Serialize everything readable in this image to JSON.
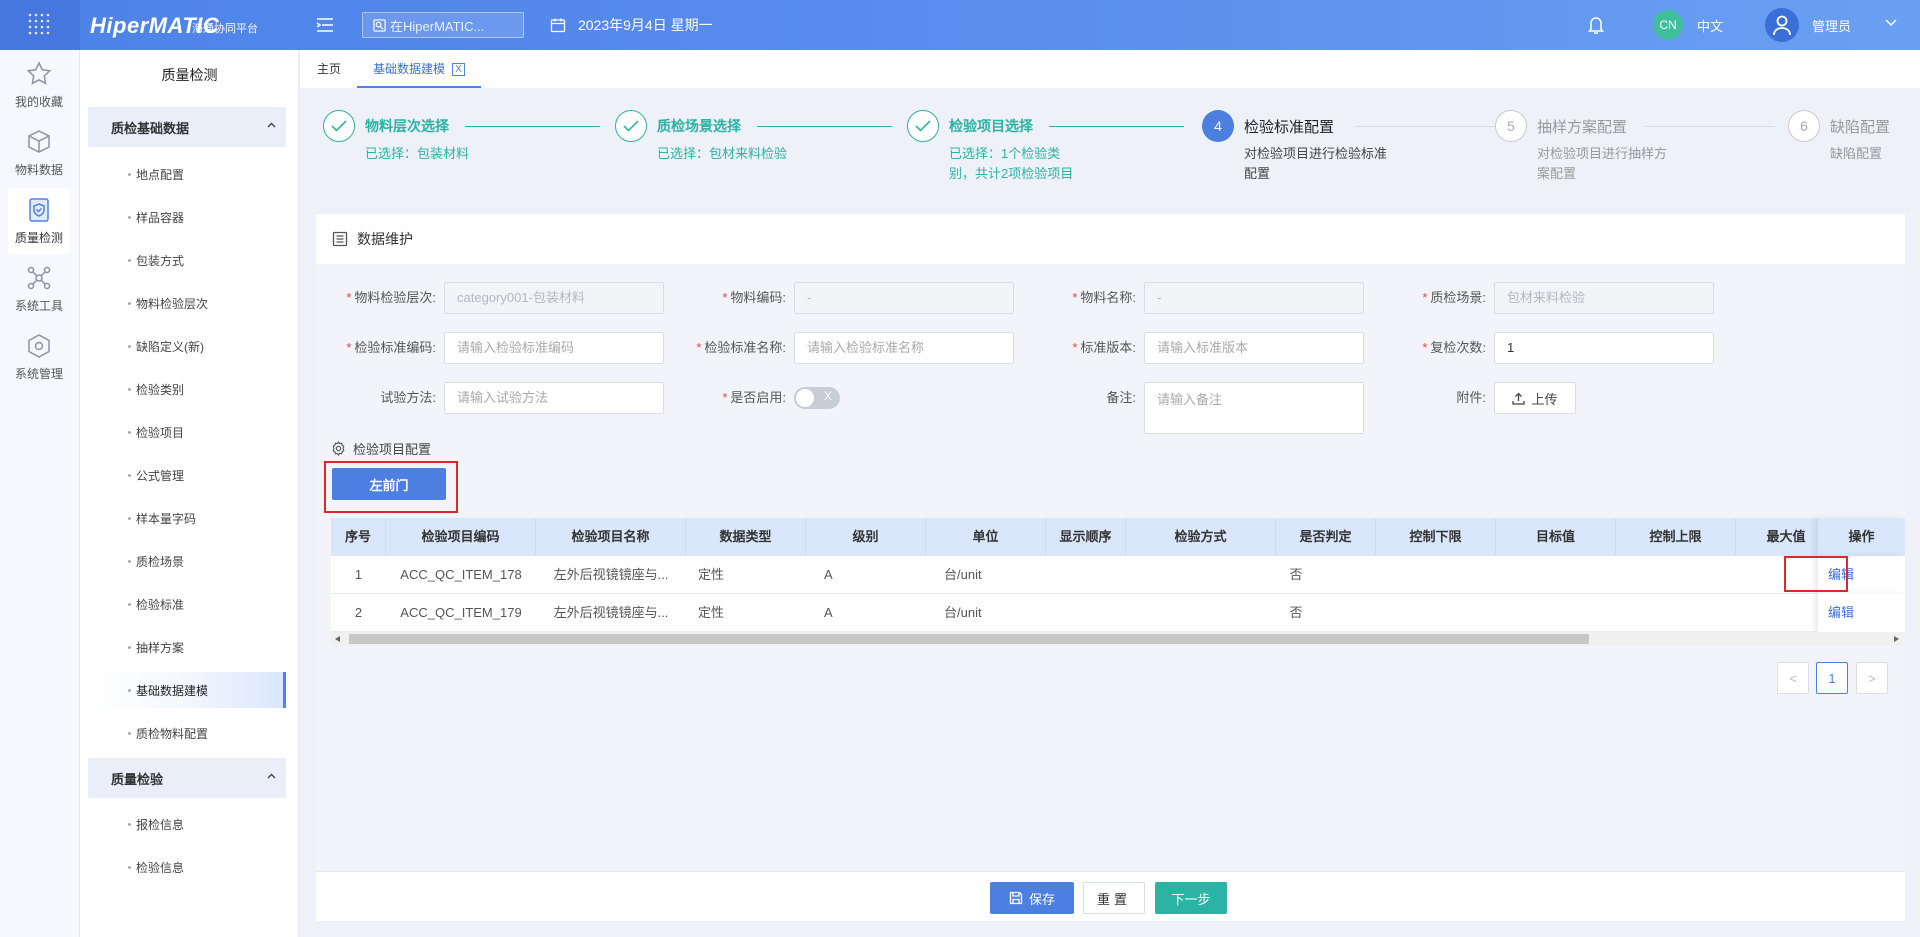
{
  "header": {
    "brand": "HiperMATIC",
    "brand_sub": "海通协同平台",
    "search_placeholder": "在HiperMATIC...",
    "date": "2023年9月4日 星期一",
    "lang_badge": "CN",
    "lang": "中文",
    "user": "管理员",
    "brand_color": "#4d82e8"
  },
  "iconbar": [
    {
      "label": "我的收藏",
      "icon": "star-icon"
    },
    {
      "label": "物料数据",
      "icon": "box-icon"
    },
    {
      "label": "质量检测",
      "icon": "shield-doc-icon",
      "active": true
    },
    {
      "label": "系统工具",
      "icon": "network-icon"
    },
    {
      "label": "系统管理",
      "icon": "cube-icon"
    }
  ],
  "sidebar": {
    "title": "质量检测",
    "groups": [
      {
        "label": "质检基础数据",
        "items": [
          "地点配置",
          "样品容器",
          "包装方式",
          "物料检验层次",
          "缺陷定义(新)",
          "检验类别",
          "检验项目",
          "公式管理",
          "样本量字码",
          "质检场景",
          "检验标准",
          "抽样方案",
          "基础数据建模",
          "质检物料配置"
        ]
      },
      {
        "label": "质量检验",
        "items": [
          "报检信息",
          "检验信息"
        ]
      }
    ],
    "active_item": "基础数据建模"
  },
  "tabs": [
    "主页",
    "基础数据建模"
  ],
  "tab_close": "X",
  "steps": [
    {
      "title": "物料层次选择",
      "desc": "已选择：包装材料",
      "status": "done"
    },
    {
      "title": "质检场景选择",
      "desc": "已选择：包材来料检验",
      "status": "done"
    },
    {
      "title": "检验项目选择",
      "desc": "已选择：1个检验类别，共计2项检验项目",
      "status": "done"
    },
    {
      "num": "4",
      "title": "检验标准配置",
      "desc": "对检验项目进行检验标准配置",
      "status": "current"
    },
    {
      "num": "5",
      "title": "抽样方案配置",
      "desc": "对检验项目进行抽样方案配置",
      "status": "wait"
    },
    {
      "num": "6",
      "title": "缺陷配置",
      "desc": "缺陷配置",
      "status": "wait"
    }
  ],
  "panel": {
    "title": "数据维护",
    "fields": {
      "level": {
        "label": "物料检验层次:",
        "value": "category001-包装材料"
      },
      "code": {
        "label": "物料编码:",
        "value": "-"
      },
      "name": {
        "label": "物料名称:",
        "value": "-"
      },
      "scene": {
        "label": "质检场景:",
        "value": "包材来料检验"
      },
      "std_code": {
        "label": "检验标准编码:",
        "placeholder": "请输入检验标准编码"
      },
      "std_name": {
        "label": "检验标准名称:",
        "placeholder": "请输入检验标准名称"
      },
      "version": {
        "label": "标准版本:",
        "placeholder": "请输入标准版本"
      },
      "recheck": {
        "label": "复检次数:",
        "value": "1"
      },
      "method": {
        "label": "试验方法:",
        "placeholder": "请输入试验方法"
      },
      "enabled": {
        "label": "是否启用:",
        "off_text": "X"
      },
      "remark": {
        "label": "备注:",
        "placeholder": "请输入备注"
      },
      "attach": {
        "label": "附件:",
        "button": "上传"
      }
    },
    "section_title": "检验项目配置",
    "primary_button": "左前门",
    "table": {
      "headers": [
        "序号",
        "检验项目编码",
        "检验项目名称",
        "数据类型",
        "级别",
        "单位",
        "显示顺序",
        "检验方式",
        "是否判定",
        "控制下限",
        "目标值",
        "控制上限",
        "最大值"
      ],
      "op_header": "操作",
      "rows": [
        {
          "no": "1",
          "code": "ACC_QC_ITEM_178",
          "name": "左外后视镜镜座与...",
          "type": "定性",
          "level": "A",
          "unit": "台/unit",
          "judge": "否",
          "op": "编辑"
        },
        {
          "no": "2",
          "code": "ACC_QC_ITEM_179",
          "name": "左外后视镜镜座与...",
          "type": "定性",
          "level": "A",
          "unit": "台/unit",
          "judge": "否",
          "op": "编辑"
        }
      ]
    },
    "pagination": {
      "prev": "<",
      "current": "1",
      "next": ">"
    },
    "footer": {
      "save": "保存",
      "reset": "重置",
      "next": "下一步"
    }
  }
}
